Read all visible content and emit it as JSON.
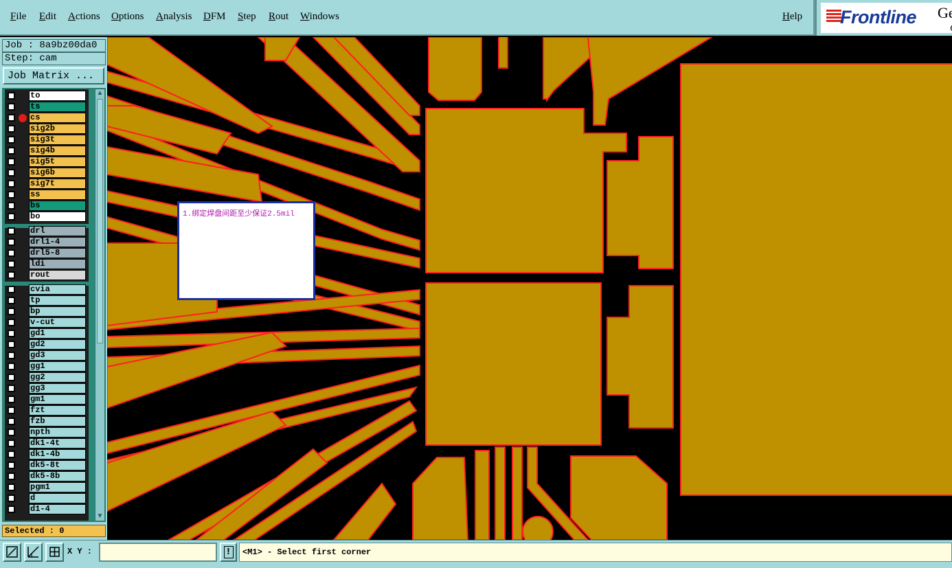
{
  "menu": [
    "File",
    "Edit",
    "Actions",
    "Options",
    "Analysis",
    "DFM",
    "Step",
    "Rout",
    "Windows"
  ],
  "help_label": "Help",
  "logo": {
    "brand": "Frontline",
    "right_text": "Ge",
    "right_sub": "G"
  },
  "job": {
    "label": "Job : 8a9bz00da0",
    "step": "Step: cam",
    "matrix_button": "Job Matrix ..."
  },
  "layers": [
    {
      "name": "to",
      "color": "#ffffff"
    },
    {
      "name": "ts",
      "color": "#139a7a"
    },
    {
      "name": "cs",
      "color": "#f2c14e",
      "active": true
    },
    {
      "name": "sig2b",
      "color": "#f2c14e"
    },
    {
      "name": "sig3t",
      "color": "#f2c14e"
    },
    {
      "name": "sig4b",
      "color": "#f2c14e"
    },
    {
      "name": "sig5t",
      "color": "#f2c14e"
    },
    {
      "name": "sig6b",
      "color": "#f2c14e"
    },
    {
      "name": "sig7t",
      "color": "#f2c14e"
    },
    {
      "name": "ss",
      "color": "#f2c14e"
    },
    {
      "name": "bs",
      "color": "#139a7a"
    },
    {
      "name": "bo",
      "color": "#ffffff"
    },
    {
      "name": "drl",
      "color": "#9bb0b8"
    },
    {
      "name": "drl1-4",
      "color": "#9bb0b8"
    },
    {
      "name": "drl5-8",
      "color": "#9bb0b8"
    },
    {
      "name": "ldi",
      "color": "#9bb0b8"
    },
    {
      "name": "rout",
      "color": "#d8d8d8"
    },
    {
      "name": "cvia",
      "color": "#a3d9db"
    },
    {
      "name": "tp",
      "color": "#a3d9db"
    },
    {
      "name": "bp",
      "color": "#a3d9db"
    },
    {
      "name": "v-cut",
      "color": "#a3d9db"
    },
    {
      "name": "gd1",
      "color": "#a3d9db"
    },
    {
      "name": "gd2",
      "color": "#a3d9db"
    },
    {
      "name": "gd3",
      "color": "#a3d9db"
    },
    {
      "name": "gg1",
      "color": "#a3d9db"
    },
    {
      "name": "gg2",
      "color": "#a3d9db"
    },
    {
      "name": "gg3",
      "color": "#a3d9db"
    },
    {
      "name": "gm1",
      "color": "#a3d9db"
    },
    {
      "name": "fzt",
      "color": "#a3d9db"
    },
    {
      "name": "fzb",
      "color": "#a3d9db"
    },
    {
      "name": "npth",
      "color": "#a3d9db"
    },
    {
      "name": "dk1-4t",
      "color": "#a3d9db"
    },
    {
      "name": "dk1-4b",
      "color": "#a3d9db"
    },
    {
      "name": "dk5-8t",
      "color": "#a3d9db"
    },
    {
      "name": "dk5-8b",
      "color": "#a3d9db"
    },
    {
      "name": "pgm1",
      "color": "#a3d9db"
    },
    {
      "name": "d",
      "color": "#a3d9db"
    },
    {
      "name": "d1-4",
      "color": "#a3d9db"
    }
  ],
  "selected": "Selected : 0",
  "note_text": "1.绑定焊盘间距至少保证2.5mil",
  "bottom": {
    "xy_label": "X Y :",
    "xy_value": "",
    "warn": "!",
    "status": "<M1> - Select first corner"
  },
  "colors": {
    "copper": "#bf9000",
    "outline": "#ff2020",
    "panel": "#a3d9db",
    "signal_layer": "#f2c14e"
  }
}
